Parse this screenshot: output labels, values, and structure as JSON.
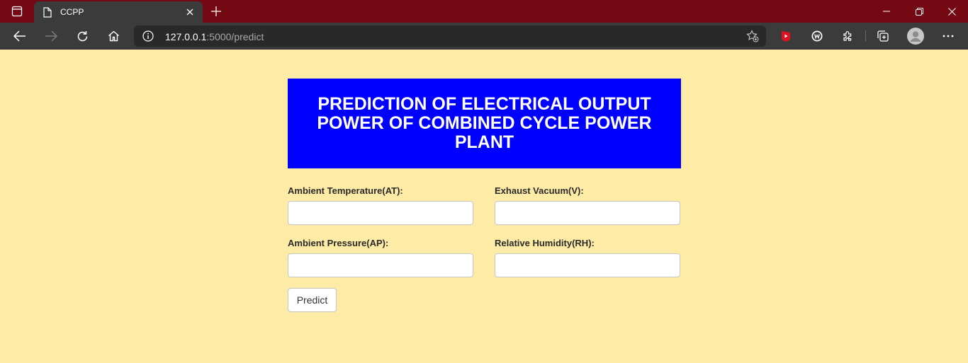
{
  "browser": {
    "tab_title": "CCPP",
    "url_host": "127.0.0.1",
    "url_rest": ":5000/predict",
    "theme_color": "#740813",
    "toolbar_color": "#3b3b3b"
  },
  "page": {
    "background": "#feeba6",
    "title": "PREDICTION OF ELECTRICAL OUTPUT POWER OF COMBINED CYCLE POWER PLANT",
    "banner_color": "#0000fe",
    "fields": [
      {
        "label": "Ambient Temperature(AT):",
        "value": ""
      },
      {
        "label": "Exhaust Vacuum(V):",
        "value": ""
      },
      {
        "label": "Ambient Pressure(AP):",
        "value": ""
      },
      {
        "label": "Relative Humidity(RH):",
        "value": ""
      }
    ],
    "submit_label": "Predict"
  }
}
